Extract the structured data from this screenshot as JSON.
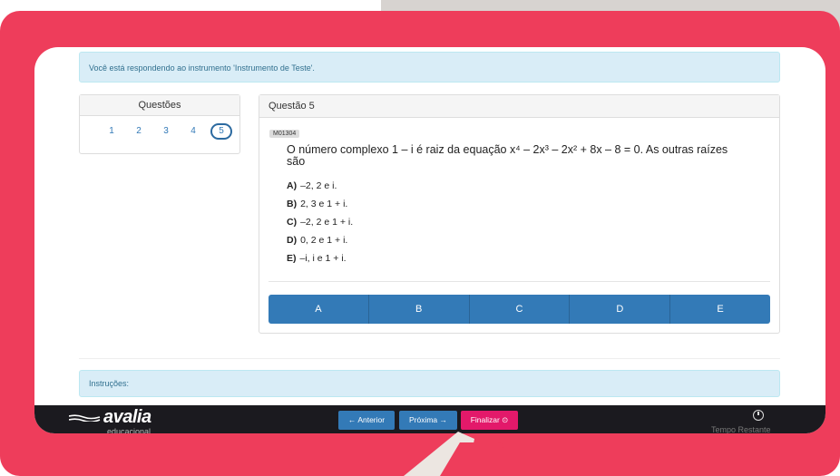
{
  "notice": "Você está respondendo ao instrumento 'Instrumento de Teste'.",
  "questions_panel": {
    "title": "Questões",
    "numbers": [
      "1",
      "2",
      "3",
      "4",
      "5"
    ],
    "active": "5"
  },
  "question": {
    "header": "Questão 5",
    "code": "M01304",
    "stem_line1": "O número complexo 1 – i é raiz da equação x⁴ – 2x³ – 2x² + 8x – 8 = 0. As outras raízes",
    "stem_line2": "são",
    "options": [
      {
        "letter": "A)",
        "text": "–2, 2 e i."
      },
      {
        "letter": "B)",
        "text": "2, 3 e 1 + i."
      },
      {
        "letter": "C)",
        "text": "–2, 2 e 1 + i."
      },
      {
        "letter": "D)",
        "text": "0, 2 e 1 + i."
      },
      {
        "letter": "E)",
        "text": "–i, i e 1 + i."
      }
    ],
    "answer_buttons": [
      "A",
      "B",
      "C",
      "D",
      "E"
    ]
  },
  "instructions": "Instruções:",
  "footer": {
    "logo": "avalia",
    "logo_sub": "educacional",
    "prev": "← Anterior",
    "next": "Próxima →",
    "finish": "Finalizar ⊙",
    "time_label": "Tempo Restante"
  },
  "colors": {
    "frame": "#ee3d5b",
    "primary": "#337ab7",
    "finish": "#e3196a",
    "footer": "#1b1a1f"
  }
}
